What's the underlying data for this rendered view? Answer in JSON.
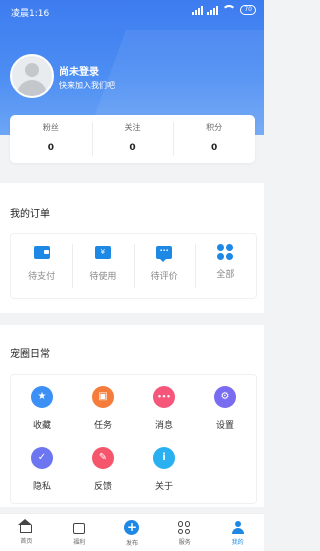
{
  "status_bar": {
    "time": "凌晨1:16",
    "battery": "70"
  },
  "profile": {
    "name": "尚未登录",
    "subtitle": "快来加入我们吧"
  },
  "stats": [
    {
      "label": "粉丝",
      "value": "0"
    },
    {
      "label": "关注",
      "value": "0"
    },
    {
      "label": "积分",
      "value": "0"
    }
  ],
  "orders": {
    "title": "我的订单",
    "items": [
      {
        "label": "待支付",
        "icon": "wallet-icon"
      },
      {
        "label": "待使用",
        "icon": "ticket-icon",
        "glyph": "¥"
      },
      {
        "label": "待评价",
        "icon": "comment-icon",
        "glyph": "···"
      },
      {
        "label": "全部",
        "icon": "grid-icon"
      }
    ]
  },
  "pet_circle": {
    "title": "宠圈日常",
    "items": [
      {
        "label": "收藏",
        "icon": "star-icon",
        "glyph": "★",
        "color": "#3b8ff5"
      },
      {
        "label": "任务",
        "icon": "task-icon",
        "glyph": "▣",
        "color": "#f57c3a"
      },
      {
        "label": "消息",
        "icon": "message-icon",
        "glyph": "•••",
        "color": "#f5567a"
      },
      {
        "label": "设置",
        "icon": "settings-icon",
        "glyph": "⚙",
        "color": "#7a6cf0"
      },
      {
        "label": "隐私",
        "icon": "shield-icon",
        "glyph": "✓",
        "color": "#6b76f0"
      },
      {
        "label": "反馈",
        "icon": "feedback-icon",
        "glyph": "✎",
        "color": "#f5566b"
      },
      {
        "label": "关于",
        "icon": "info-icon",
        "glyph": "i",
        "color": "#29b0f0"
      }
    ]
  },
  "tabbar": [
    {
      "label": "首页",
      "icon": "home-icon"
    },
    {
      "label": "福利",
      "icon": "gift-icon"
    },
    {
      "label": "发布",
      "icon": "plus-icon",
      "glyph": "+"
    },
    {
      "label": "服务",
      "icon": "services-icon"
    },
    {
      "label": "我的",
      "icon": "user-icon",
      "active": true
    }
  ],
  "colors": {
    "accent": "#1e88e5",
    "header_top": "#3d7cf0",
    "header_bottom": "#6da6f6"
  }
}
